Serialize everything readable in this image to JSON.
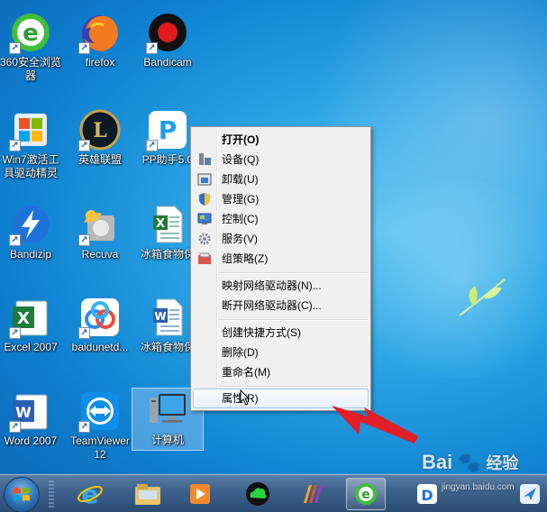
{
  "desktop": {
    "icons": [
      {
        "label": "360安全浏览\n器"
      },
      {
        "label": "firefox"
      },
      {
        "label": "Bandicam"
      },
      {
        "label": "Win7激活工\n具驱动精灵"
      },
      {
        "label": "英雄联盟"
      },
      {
        "label": "PP助手5.0"
      },
      {
        "label": "Bandizip"
      },
      {
        "label": "Recuva"
      },
      {
        "label": "冰箱食物保"
      },
      {
        "label": "Excel 2007"
      },
      {
        "label": "baidunetd..."
      },
      {
        "label": "冰箱食物保"
      },
      {
        "label": "Word 2007"
      },
      {
        "label": "TeamViewer\n12"
      },
      {
        "label": "计算机"
      }
    ]
  },
  "context_menu": {
    "items": [
      {
        "label": "打开(O)"
      },
      {
        "label": "设备(Q)"
      },
      {
        "label": "卸载(U)"
      },
      {
        "label": "管理(G)"
      },
      {
        "label": "控制(C)"
      },
      {
        "label": "服务(V)"
      },
      {
        "label": "组策略(Z)"
      },
      {
        "label": "映射网络驱动器(N)..."
      },
      {
        "label": "断开网络驱动器(C)..."
      },
      {
        "label": "创建快捷方式(S)"
      },
      {
        "label": "删除(D)"
      },
      {
        "label": "重命名(M)"
      },
      {
        "label": "属性(R)"
      }
    ]
  },
  "watermark": {
    "brand": "Bai",
    "brand_cn": "经验",
    "url": "jingyan.baidu.com"
  },
  "colors": {
    "desktop_bg": "#1a8ad8",
    "menu_bg": "#f0f0f0",
    "highlight_border": "#a8c7ec",
    "arrow": "#e21e26"
  }
}
